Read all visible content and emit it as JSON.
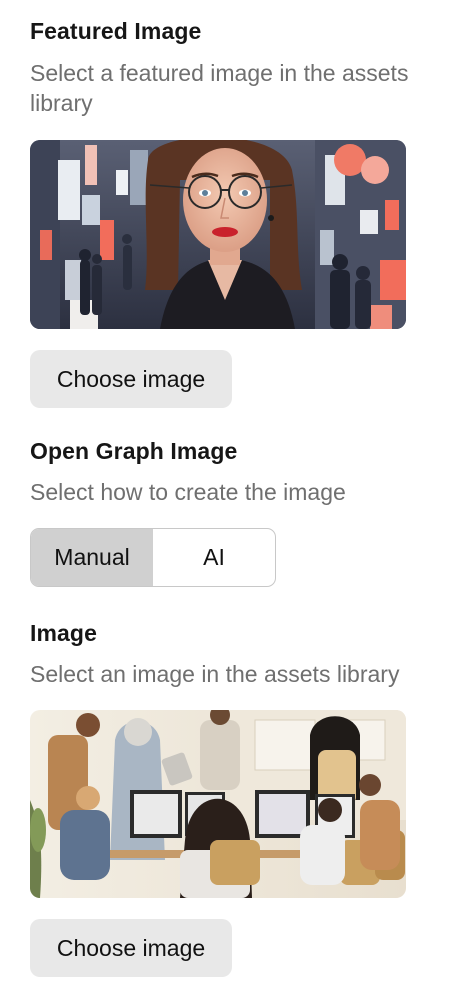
{
  "featured": {
    "title": "Featured Image",
    "description": "Select a featured image in the assets library",
    "button_label": "Choose image"
  },
  "open_graph": {
    "title": "Open Graph Image",
    "description": "Select how to create the image",
    "options": [
      "Manual",
      "AI"
    ],
    "selected": "Manual"
  },
  "image": {
    "title": "Image",
    "description": "Select an image in the assets library",
    "button_label": "Choose image"
  }
}
